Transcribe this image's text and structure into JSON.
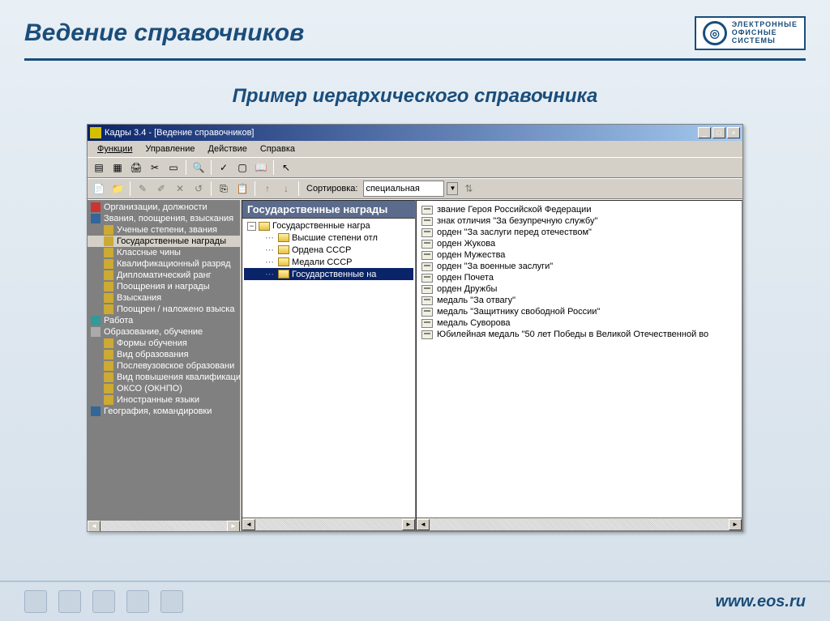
{
  "slide": {
    "title": "Ведение справочников",
    "subtitle": "Пример иерархического справочника",
    "logo_lines": [
      "ЭЛЕКТРОННЫЕ",
      "ОФИСНЫЕ",
      "СИСТЕМЫ"
    ],
    "footer_url": "www.eos.ru"
  },
  "window": {
    "title": "Кадры 3.4 - [Ведение справочников]",
    "menu": [
      "Функции",
      "Управление",
      "Действие",
      "Справка"
    ],
    "sort_label": "Сортировка:",
    "sort_value": "специальная"
  },
  "left_tree": [
    {
      "label": "Организации, должности",
      "level": 1,
      "color": "color-red"
    },
    {
      "label": "Звания, поощрения, взыскания",
      "level": 1,
      "color": "color-blue"
    },
    {
      "label": "Ученые степени, звания",
      "level": 2,
      "color": "color-yellow"
    },
    {
      "label": "Государственные награды",
      "level": 2,
      "color": "color-yellow",
      "selected": true
    },
    {
      "label": "Классные чины",
      "level": 2,
      "color": "color-yellow"
    },
    {
      "label": "Квалификационный разряд",
      "level": 2,
      "color": "color-yellow"
    },
    {
      "label": "Дипломатический ранг",
      "level": 2,
      "color": "color-yellow"
    },
    {
      "label": "Поощрения и награды",
      "level": 2,
      "color": "color-yellow"
    },
    {
      "label": "Взыскания",
      "level": 2,
      "color": "color-yellow"
    },
    {
      "label": "Поощрен / наложено взыска",
      "level": 2,
      "color": "color-yellow"
    },
    {
      "label": "Работа",
      "level": 1,
      "color": "color-teal"
    },
    {
      "label": "Образование, обучение",
      "level": 1,
      "color": "color-gray"
    },
    {
      "label": "Формы обучения",
      "level": 2,
      "color": "color-yellow"
    },
    {
      "label": "Вид образования",
      "level": 2,
      "color": "color-yellow"
    },
    {
      "label": "Послевузовское образовани",
      "level": 2,
      "color": "color-yellow"
    },
    {
      "label": "Вид повышения квалификаци",
      "level": 2,
      "color": "color-yellow"
    },
    {
      "label": "ОКСО (ОКНПО)",
      "level": 2,
      "color": "color-yellow"
    },
    {
      "label": "Иностранные языки",
      "level": 2,
      "color": "color-yellow"
    },
    {
      "label": "География, командировки",
      "level": 1,
      "color": "color-blue"
    }
  ],
  "middle": {
    "header": "Государственные награды",
    "items": [
      {
        "label": "Государственные награ",
        "level": 1,
        "exp": "−"
      },
      {
        "label": "Высшие степени отл",
        "level": 2
      },
      {
        "label": "Ордена СССР",
        "level": 2
      },
      {
        "label": "Медали СССР",
        "level": 2
      },
      {
        "label": "Государственные на",
        "level": 2,
        "selected": true
      }
    ]
  },
  "right_list": [
    "звание Героя Российской Федерации",
    "знак отличия \"За безупречную службу\"",
    "орден \"За заслуги перед отечеством\"",
    "орден Жукова",
    "орден Мужества",
    "орден \"За военные заслуги\"",
    "орден Почета",
    "орден Дружбы",
    "медаль \"За отвагу\"",
    "медаль \"Защитнику свободной России\"",
    "медаль Суворова",
    "Юбилейная медаль \"50 лет Победы в Великой Отечественной во"
  ]
}
